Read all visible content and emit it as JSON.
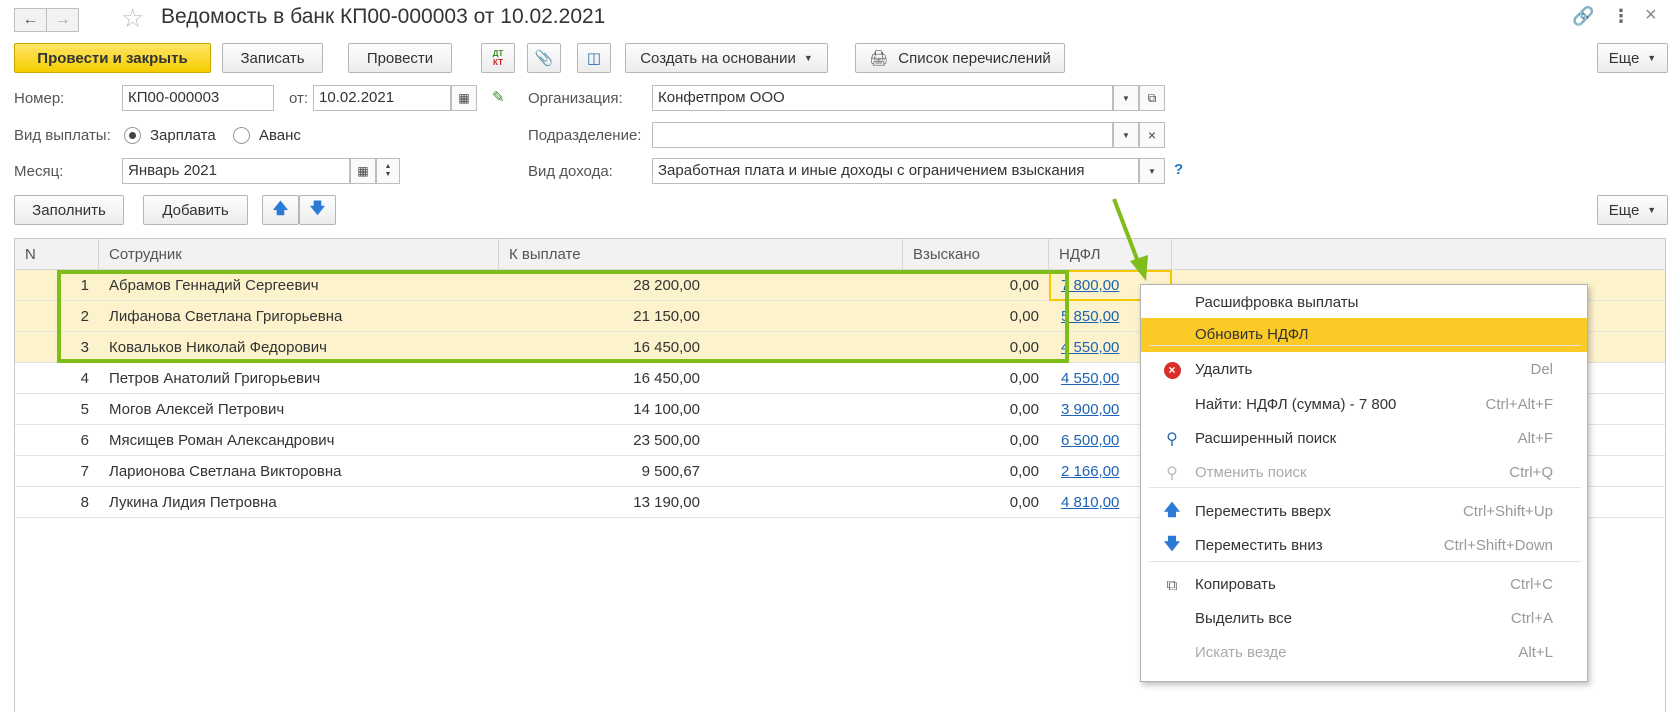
{
  "window": {
    "title": "Ведомость в банк КП00-000003 от 10.02.2021"
  },
  "toolbar": {
    "post_and_close": "Провести и закрыть",
    "save": "Записать",
    "post": "Провести",
    "dt_kt_top": "ДТ",
    "dt_kt_bottom": "КТ",
    "create_based_on": "Создать на основании",
    "transfer_list": "Список перечислений",
    "more": "Еще"
  },
  "form": {
    "number_label": "Номер:",
    "number_value": "КП00-000003",
    "date_label": "от:",
    "date_value": "10.02.2021",
    "organization_label": "Организация:",
    "organization_value": "Конфетпром ООО",
    "payment_type_label": "Вид выплаты:",
    "payment_type_options": [
      "Зарплата",
      "Аванс"
    ],
    "payment_type_selected": "Зарплата",
    "department_label": "Подразделение:",
    "department_value": "",
    "month_label": "Месяц:",
    "month_value": "Январь 2021",
    "income_type_label": "Вид дохода:",
    "income_type_value": "Заработная плата и иные доходы с ограничением взыскания",
    "help": "?"
  },
  "table_toolbar": {
    "fill": "Заполнить",
    "add": "Добавить",
    "more": "Еще"
  },
  "table": {
    "columns": [
      "N",
      "Сотрудник",
      "К выплате",
      "Взыскано",
      "НДФЛ"
    ],
    "rows": [
      {
        "n": "1",
        "employee": "Абрамов Геннадий Сергеевич",
        "payout": "28 200,00",
        "recovered": "0,00",
        "ndfl": "7 800,00"
      },
      {
        "n": "2",
        "employee": "Лифанова Светлана Григорьевна",
        "payout": "21 150,00",
        "recovered": "0,00",
        "ndfl": "5 850,00"
      },
      {
        "n": "3",
        "employee": "Ковальков Николай Федорович",
        "payout": "16 450,00",
        "recovered": "0,00",
        "ndfl": "4 550,00"
      },
      {
        "n": "4",
        "employee": "Петров Анатолий Григорьевич",
        "payout": "16 450,00",
        "recovered": "0,00",
        "ndfl": "4 550,00"
      },
      {
        "n": "5",
        "employee": "Могов Алексей Петрович",
        "payout": "14 100,00",
        "recovered": "0,00",
        "ndfl": "3 900,00"
      },
      {
        "n": "6",
        "employee": "Мясищев Роман Александрович",
        "payout": "23 500,00",
        "recovered": "0,00",
        "ndfl": "6 500,00"
      },
      {
        "n": "7",
        "employee": "Ларионова Светлана Викторовна",
        "payout": "9 500,67",
        "recovered": "0,00",
        "ndfl": "2 166,00"
      },
      {
        "n": "8",
        "employee": "Лукина Лидия Петровна",
        "payout": "13 190,00",
        "recovered": "0,00",
        "ndfl": "4 810,00"
      }
    ]
  },
  "context_menu": {
    "items": [
      {
        "label": "Расшифровка выплаты",
        "shortcut": "",
        "icon": ""
      },
      {
        "label": "Обновить НДФЛ",
        "shortcut": "",
        "icon": "",
        "highlighted": true
      },
      {
        "label": "Удалить",
        "shortcut": "Del",
        "icon": "delete-icon"
      },
      {
        "label": "Найти: НДФЛ (сумма) - 7 800",
        "shortcut": "Ctrl+Alt+F",
        "icon": ""
      },
      {
        "label": "Расширенный поиск",
        "shortcut": "Alt+F",
        "icon": "search-icon"
      },
      {
        "label": "Отменить поиск",
        "shortcut": "Ctrl+Q",
        "icon": "cancel-search-icon",
        "disabled": true
      },
      {
        "label": "Переместить вверх",
        "shortcut": "Ctrl+Shift+Up",
        "icon": "arrow-up-icon"
      },
      {
        "label": "Переместить вниз",
        "shortcut": "Ctrl+Shift+Down",
        "icon": "arrow-down-icon"
      },
      {
        "label": "Копировать",
        "shortcut": "Ctrl+C",
        "icon": "copy-icon"
      },
      {
        "label": "Выделить все",
        "shortcut": "Ctrl+A",
        "icon": ""
      },
      {
        "label": "Искать везде",
        "shortcut": "Alt+L",
        "icon": "",
        "disabled": true
      }
    ]
  },
  "colors": {
    "primary_button": "#f5cd00",
    "selected_row": "#fcf2cc",
    "menu_highlight": "#fbca26",
    "annotation_green": "#7fbd1a",
    "link": "#1e63b4"
  }
}
